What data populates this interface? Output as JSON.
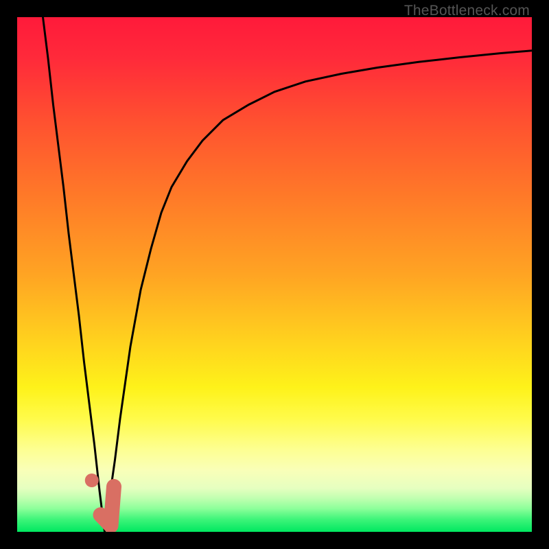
{
  "watermark": "TheBottleneck.com",
  "colors": {
    "frame": "#000000",
    "gradient_stops": [
      {
        "offset": 0.0,
        "color": "#ff1a3a"
      },
      {
        "offset": 0.08,
        "color": "#ff2a3a"
      },
      {
        "offset": 0.2,
        "color": "#ff5030"
      },
      {
        "offset": 0.35,
        "color": "#ff7a28"
      },
      {
        "offset": 0.5,
        "color": "#ffa423"
      },
      {
        "offset": 0.63,
        "color": "#ffd21e"
      },
      {
        "offset": 0.72,
        "color": "#fef21a"
      },
      {
        "offset": 0.78,
        "color": "#fffb4a"
      },
      {
        "offset": 0.84,
        "color": "#fdff92"
      },
      {
        "offset": 0.88,
        "color": "#f9ffb8"
      },
      {
        "offset": 0.915,
        "color": "#e6ffc0"
      },
      {
        "offset": 0.935,
        "color": "#c0ffb0"
      },
      {
        "offset": 0.955,
        "color": "#8cff9a"
      },
      {
        "offset": 0.975,
        "color": "#40f57a"
      },
      {
        "offset": 1.0,
        "color": "#00e860"
      }
    ],
    "curve": "#000000",
    "marker_fill": "#d96f63",
    "marker_stroke": "#d96f63"
  },
  "chart_data": {
    "type": "line",
    "title": "",
    "xlabel": "",
    "ylabel": "",
    "xlim": [
      0,
      100
    ],
    "ylim": [
      0,
      100
    ],
    "grid": false,
    "series": [
      {
        "name": "left-branch",
        "x": [
          5,
          6,
          7,
          8,
          9,
          10,
          11,
          12,
          13,
          14,
          15,
          16,
          17
        ],
        "y": [
          100,
          92,
          83,
          75,
          67,
          58,
          50,
          42,
          33,
          25,
          17,
          8,
          0
        ]
      },
      {
        "name": "right-branch",
        "x": [
          17,
          18,
          19,
          20,
          21,
          22,
          24,
          26,
          28,
          30,
          33,
          36,
          40,
          45,
          50,
          56,
          63,
          70,
          78,
          86,
          94,
          100
        ],
        "y": [
          0,
          7,
          14,
          22,
          29,
          36,
          47,
          55,
          62,
          67,
          72,
          76,
          80,
          83,
          85.5,
          87.5,
          89,
          90.2,
          91.3,
          92.2,
          93,
          93.5
        ]
      }
    ],
    "markers": [
      {
        "name": "small-dot",
        "x": 14.5,
        "y": 10
      },
      {
        "name": "hook-left",
        "x": 16.2,
        "y": 3.3
      },
      {
        "name": "hook-bottom",
        "x": 18.2,
        "y": 1.2
      },
      {
        "name": "hook-top",
        "x": 18.8,
        "y": 8.8
      }
    ]
  }
}
